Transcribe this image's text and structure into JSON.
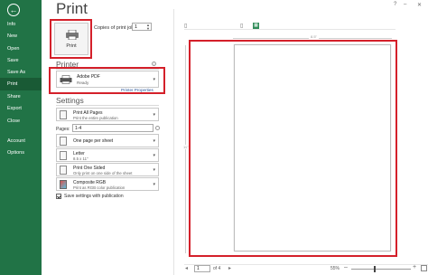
{
  "nav": {
    "back_icon": "back-arrow-icon",
    "items": [
      {
        "label": "Info"
      },
      {
        "label": "New"
      },
      {
        "label": "Open"
      },
      {
        "label": "Save"
      },
      {
        "label": "Save As"
      },
      {
        "label": "Print",
        "active": true
      },
      {
        "label": "Share"
      },
      {
        "label": "Export"
      },
      {
        "label": "Close"
      },
      {
        "label": "Account"
      },
      {
        "label": "Options"
      }
    ],
    "colors": {
      "background": "#217346",
      "active": "#195a35"
    }
  },
  "page_title": "Print",
  "print_button": {
    "label": "Print"
  },
  "copies": {
    "label": "Copies of print job:",
    "value": "1"
  },
  "printer": {
    "header": "Printer",
    "name": "Adobe PDF",
    "status": "Ready",
    "properties_link": "Printer Properties"
  },
  "settings": {
    "header": "Settings",
    "print_range": {
      "title": "Print All Pages",
      "subtitle": "Print the entire publication"
    },
    "pages": {
      "label": "Pages:",
      "value": "1-4"
    },
    "layout": {
      "title": "One page per sheet"
    },
    "paper": {
      "title": "Letter",
      "subtitle": "8.5 x 11\""
    },
    "sides": {
      "title": "Print One Sided",
      "subtitle": "Only print on one side of the sheet"
    },
    "color": {
      "title": "Composite RGB",
      "subtitle": "Print as RGB color publication"
    },
    "save_settings": {
      "label": "Save settings with publication",
      "checked": true
    }
  },
  "preview": {
    "ruler_top": "8.5\"",
    "ruler_left": "11\"",
    "current_page": "1",
    "of_pages": "of 4",
    "zoom": "55%"
  },
  "highlight_color": "#d4202a"
}
